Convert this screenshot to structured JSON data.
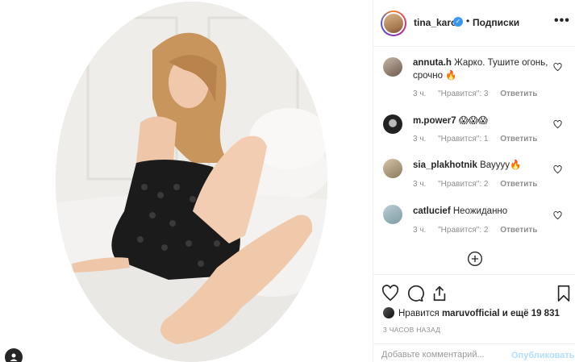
{
  "post": {
    "author": "tina_karol",
    "follow_label": "Подписки",
    "dot_separator": "•",
    "more_label": "•••"
  },
  "comments": [
    {
      "user": "annuta.h",
      "text": "Жарко. Тушите огонь, срочно 🔥",
      "time": "3 ч.",
      "likes": "\"Нравится\": 3",
      "reply": "Ответить"
    },
    {
      "user": "m.power7",
      "text": "😱😱😱",
      "time": "3 ч.",
      "likes": "\"Нравится\": 1",
      "reply": "Ответить"
    },
    {
      "user": "sia_plakhotnik",
      "text": "Вауууу🔥",
      "time": "3 ч.",
      "likes": "\"Нравится\": 2",
      "reply": "Ответить"
    },
    {
      "user": "catlucief",
      "text": "Неожиданно",
      "time": "3 ч.",
      "likes": "\"Нравится\": 2",
      "reply": "Ответить"
    }
  ],
  "likes": {
    "prefix": "Нравится",
    "user": "maruvofficial",
    "suffix": "и ещё 19 831"
  },
  "timestamp": "3 ЧАСОВ НАЗАД",
  "add_comment": {
    "placeholder": "Добавьте комментарий...",
    "publish_label": "Опубликовать"
  },
  "colors": {
    "accent": "#3897f0",
    "publish_disabled": "#b2dffc",
    "muted": "#8e8e8e"
  },
  "icons": [
    "heart-icon",
    "comment-icon",
    "share-icon",
    "bookmark-icon",
    "add-circle-icon",
    "verified-icon",
    "more-icon"
  ]
}
